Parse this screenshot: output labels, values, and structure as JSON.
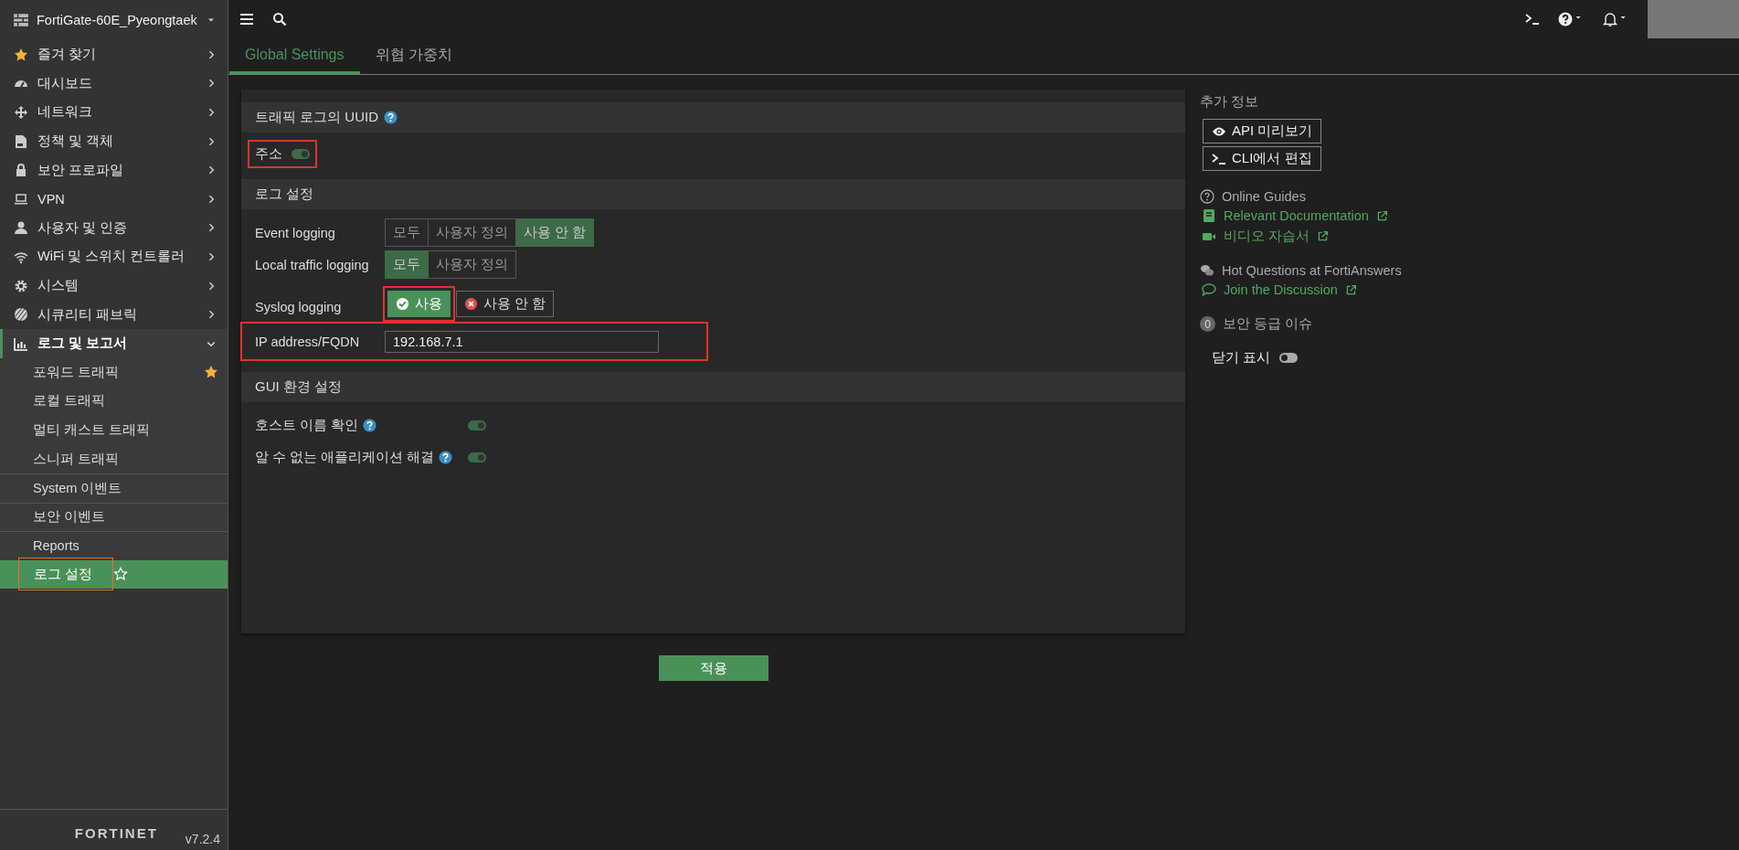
{
  "sidebar": {
    "device": "FortiGate-60E_Pyeongtaek",
    "items": [
      {
        "label": "즐겨 찾기",
        "expanded": false
      },
      {
        "label": "대시보드",
        "expanded": false
      },
      {
        "label": "네트워크",
        "expanded": false
      },
      {
        "label": "정책 및 객체",
        "expanded": false
      },
      {
        "label": "보안 프로파일",
        "expanded": false
      },
      {
        "label": "VPN",
        "expanded": false
      },
      {
        "label": "사용자 및 인증",
        "expanded": false
      },
      {
        "label": "WiFi 및 스위치 컨트롤러",
        "expanded": false
      },
      {
        "label": "시스템",
        "expanded": false
      },
      {
        "label": "시큐리티 패브릭",
        "expanded": false
      },
      {
        "label": "로그 및 보고서",
        "expanded": true,
        "children": [
          {
            "label": "포워드 트래픽",
            "selected": false,
            "favorite": true,
            "divided": false,
            "highlighted": false
          },
          {
            "label": "로컬 트래픽",
            "selected": false,
            "favorite": false,
            "divided": false,
            "highlighted": false
          },
          {
            "label": "멀티 캐스트 트래픽",
            "selected": false,
            "favorite": false,
            "divided": false,
            "highlighted": false
          },
          {
            "label": "스니퍼 트래픽",
            "selected": false,
            "favorite": false,
            "divided": false,
            "highlighted": false
          },
          {
            "label": "System 이벤트",
            "selected": false,
            "favorite": false,
            "divided": true,
            "highlighted": false
          },
          {
            "label": "보안 이벤트",
            "selected": false,
            "favorite": false,
            "divided": true,
            "highlighted": false
          },
          {
            "label": "Reports",
            "selected": false,
            "favorite": false,
            "divided": true,
            "highlighted": false
          },
          {
            "label": "로그 설정",
            "selected": true,
            "favorite": false,
            "divided": false,
            "highlighted": true
          }
        ]
      }
    ],
    "logo": "FORTINET",
    "version": "v7.2.4"
  },
  "tabs": [
    {
      "label": "Global Settings",
      "selected": true
    },
    {
      "label": "위협 가중치",
      "selected": false
    }
  ],
  "sections": [
    {
      "title": "트래픽 로그의 UUID",
      "help": true,
      "fields": [
        {
          "kind": "inline_toggle",
          "label": "주소",
          "on": true,
          "highlighted": true
        }
      ]
    },
    {
      "title": "로그 설정",
      "help": false,
      "fields": [
        {
          "kind": "segmented",
          "label": "Event logging",
          "highlighted": false,
          "options": [
            {
              "label": "모두",
              "selected": false
            },
            {
              "label": "사용자 정의",
              "selected": false
            },
            {
              "label": "사용 안 함",
              "selected": true
            }
          ]
        },
        {
          "kind": "segmented",
          "label": "Local traffic logging",
          "highlighted": false,
          "options": [
            {
              "label": "모두",
              "selected": true
            },
            {
              "label": "사용자 정의",
              "selected": false
            }
          ]
        },
        {
          "kind": "enable",
          "label": "Syslog logging",
          "highlighted": false,
          "options": [
            {
              "label": "사용",
              "selected": true,
              "highlighted": true
            },
            {
              "label": "사용 안 함",
              "selected": false,
              "highlighted": false
            }
          ]
        },
        {
          "kind": "text",
          "label": "IP address/FQDN",
          "value": "192.168.7.1",
          "highlighted": true
        }
      ]
    },
    {
      "title": "GUI 환경 설정",
      "help": false,
      "fields": [
        {
          "kind": "toggle",
          "label": "호스트 이름 확인",
          "help": true,
          "on": true,
          "highlighted": false
        },
        {
          "kind": "toggle",
          "label": "알 수 없는 애플리케이션 해결",
          "help": true,
          "on": true,
          "highlighted": false
        }
      ]
    }
  ],
  "apply_button": "적용",
  "info": {
    "title": "추가 정보",
    "buttons": [
      "API 미리보기",
      "CLI에서 편집"
    ],
    "guides_title": "Online Guides",
    "guide_links": [
      "Relevant Documentation",
      "비디오 자습서"
    ],
    "answers_title": "Hot Questions at FortiAnswers",
    "answers_link": "Join the Discussion",
    "issues_count": "0",
    "issues_title": "보안 등급 이슈",
    "dismissed_label": "닫기 표시",
    "dismissed_on": false
  }
}
